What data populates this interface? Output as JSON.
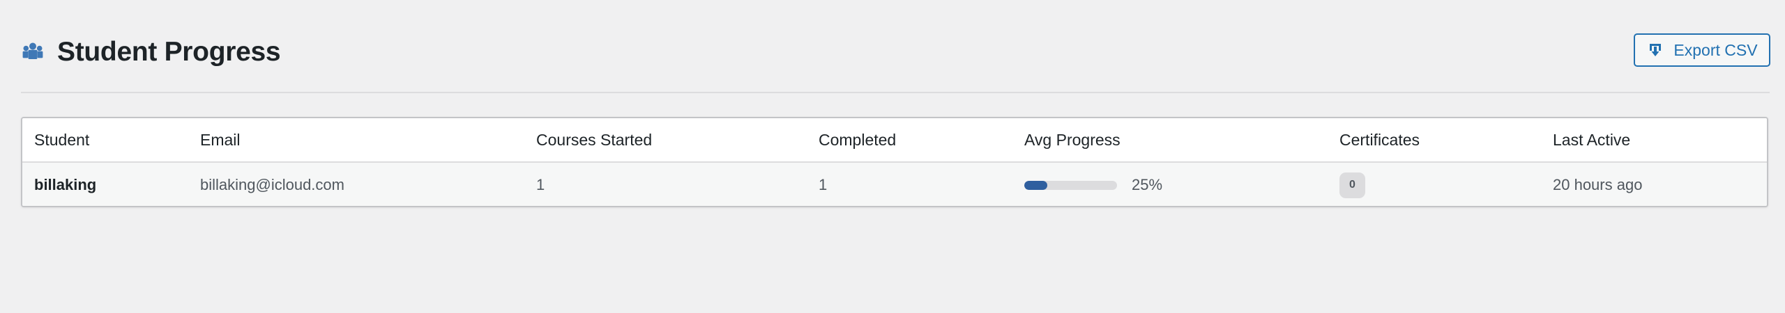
{
  "page": {
    "title": "Student Progress",
    "title_icon": "users-group-icon"
  },
  "toolbar": {
    "export_label": "Export CSV",
    "export_icon": "download-icon"
  },
  "table": {
    "headers": {
      "student": "Student",
      "email": "Email",
      "courses_started": "Courses Started",
      "completed": "Completed",
      "avg_progress": "Avg Progress",
      "certificates": "Certificates",
      "last_active": "Last Active"
    },
    "rows": [
      {
        "student": "billaking",
        "email": "billaking@icloud.com",
        "courses_started": "1",
        "completed": "1",
        "avg_progress_value": 25,
        "avg_progress_label": "25%",
        "certificates": "0",
        "last_active": "20 hours ago"
      }
    ]
  },
  "colors": {
    "accent": "#2271b1",
    "progress_fill": "#2f5f9f",
    "title_icon": "#3f78b6"
  }
}
